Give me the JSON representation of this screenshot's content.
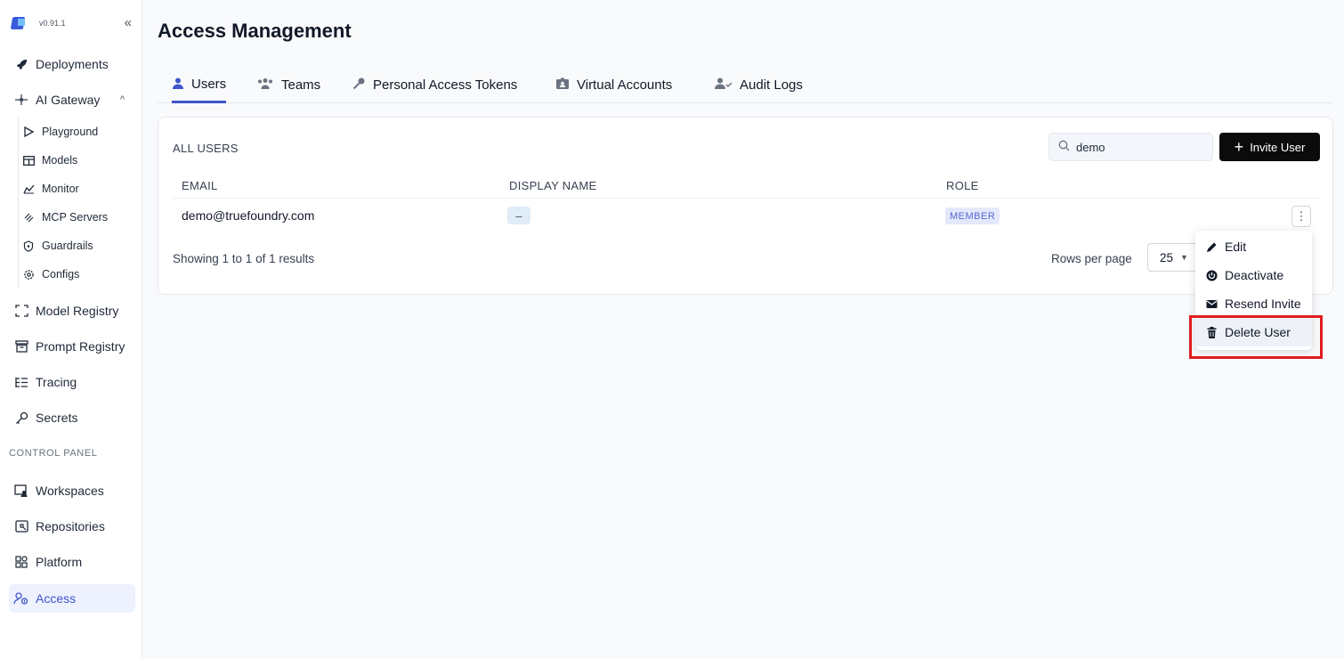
{
  "sidebar": {
    "version": "v0.91.1",
    "collapse_icon": "«",
    "items": [
      {
        "label": "Deployments",
        "icon": "rocket-icon"
      },
      {
        "label": "AI Gateway",
        "icon": "gateway-icon",
        "expanded": true
      },
      {
        "label": "Model Registry",
        "icon": "model-registry-icon"
      },
      {
        "label": "Prompt Registry",
        "icon": "prompt-registry-icon"
      },
      {
        "label": "Tracing",
        "icon": "tracing-icon"
      },
      {
        "label": "Secrets",
        "icon": "key-icon"
      }
    ],
    "gateway_subitems": [
      {
        "label": "Playground",
        "icon": "play-icon"
      },
      {
        "label": "Models",
        "icon": "table-icon"
      },
      {
        "label": "Monitor",
        "icon": "monitor-icon"
      },
      {
        "label": "MCP Servers",
        "icon": "mcp-icon"
      },
      {
        "label": "Guardrails",
        "icon": "shield-icon"
      },
      {
        "label": "Configs",
        "icon": "gear-icon"
      }
    ],
    "control_panel_label": "CONTROL PANEL",
    "control_items": [
      {
        "label": "Workspaces",
        "icon": "workspaces-icon"
      },
      {
        "label": "Repositories",
        "icon": "repositories-icon"
      },
      {
        "label": "Platform",
        "icon": "platform-icon"
      },
      {
        "label": "Access",
        "icon": "access-icon",
        "active": true
      }
    ]
  },
  "page": {
    "title": "Access Management",
    "tabs": [
      {
        "label": "Users",
        "active": true
      },
      {
        "label": "Teams"
      },
      {
        "label": "Personal Access Tokens"
      },
      {
        "label": "Virtual Accounts"
      },
      {
        "label": "Audit Logs"
      }
    ]
  },
  "users_card": {
    "title": "ALL USERS",
    "search_value": "demo",
    "invite_label": "Invite User",
    "columns": [
      "EMAIL",
      "DISPLAY NAME",
      "ROLE"
    ],
    "rows": [
      {
        "email": "demo@truefoundry.com",
        "display_name": "–",
        "role": "MEMBER"
      }
    ],
    "showing": "Showing 1 to 1 of 1 results",
    "rows_per_page_label": "Rows per page",
    "rows_per_page_value": "25"
  },
  "row_menu": {
    "items": [
      {
        "label": "Edit",
        "icon": "pencil-icon"
      },
      {
        "label": "Deactivate",
        "icon": "power-icon"
      },
      {
        "label": "Resend Invite",
        "icon": "envelope-icon"
      },
      {
        "label": "Delete User",
        "icon": "trash-icon",
        "highlighted": true
      }
    ]
  },
  "colors": {
    "accent": "#4054c9",
    "highlight_box": "#e11d1d",
    "primary_button": "#0b0b0c"
  }
}
